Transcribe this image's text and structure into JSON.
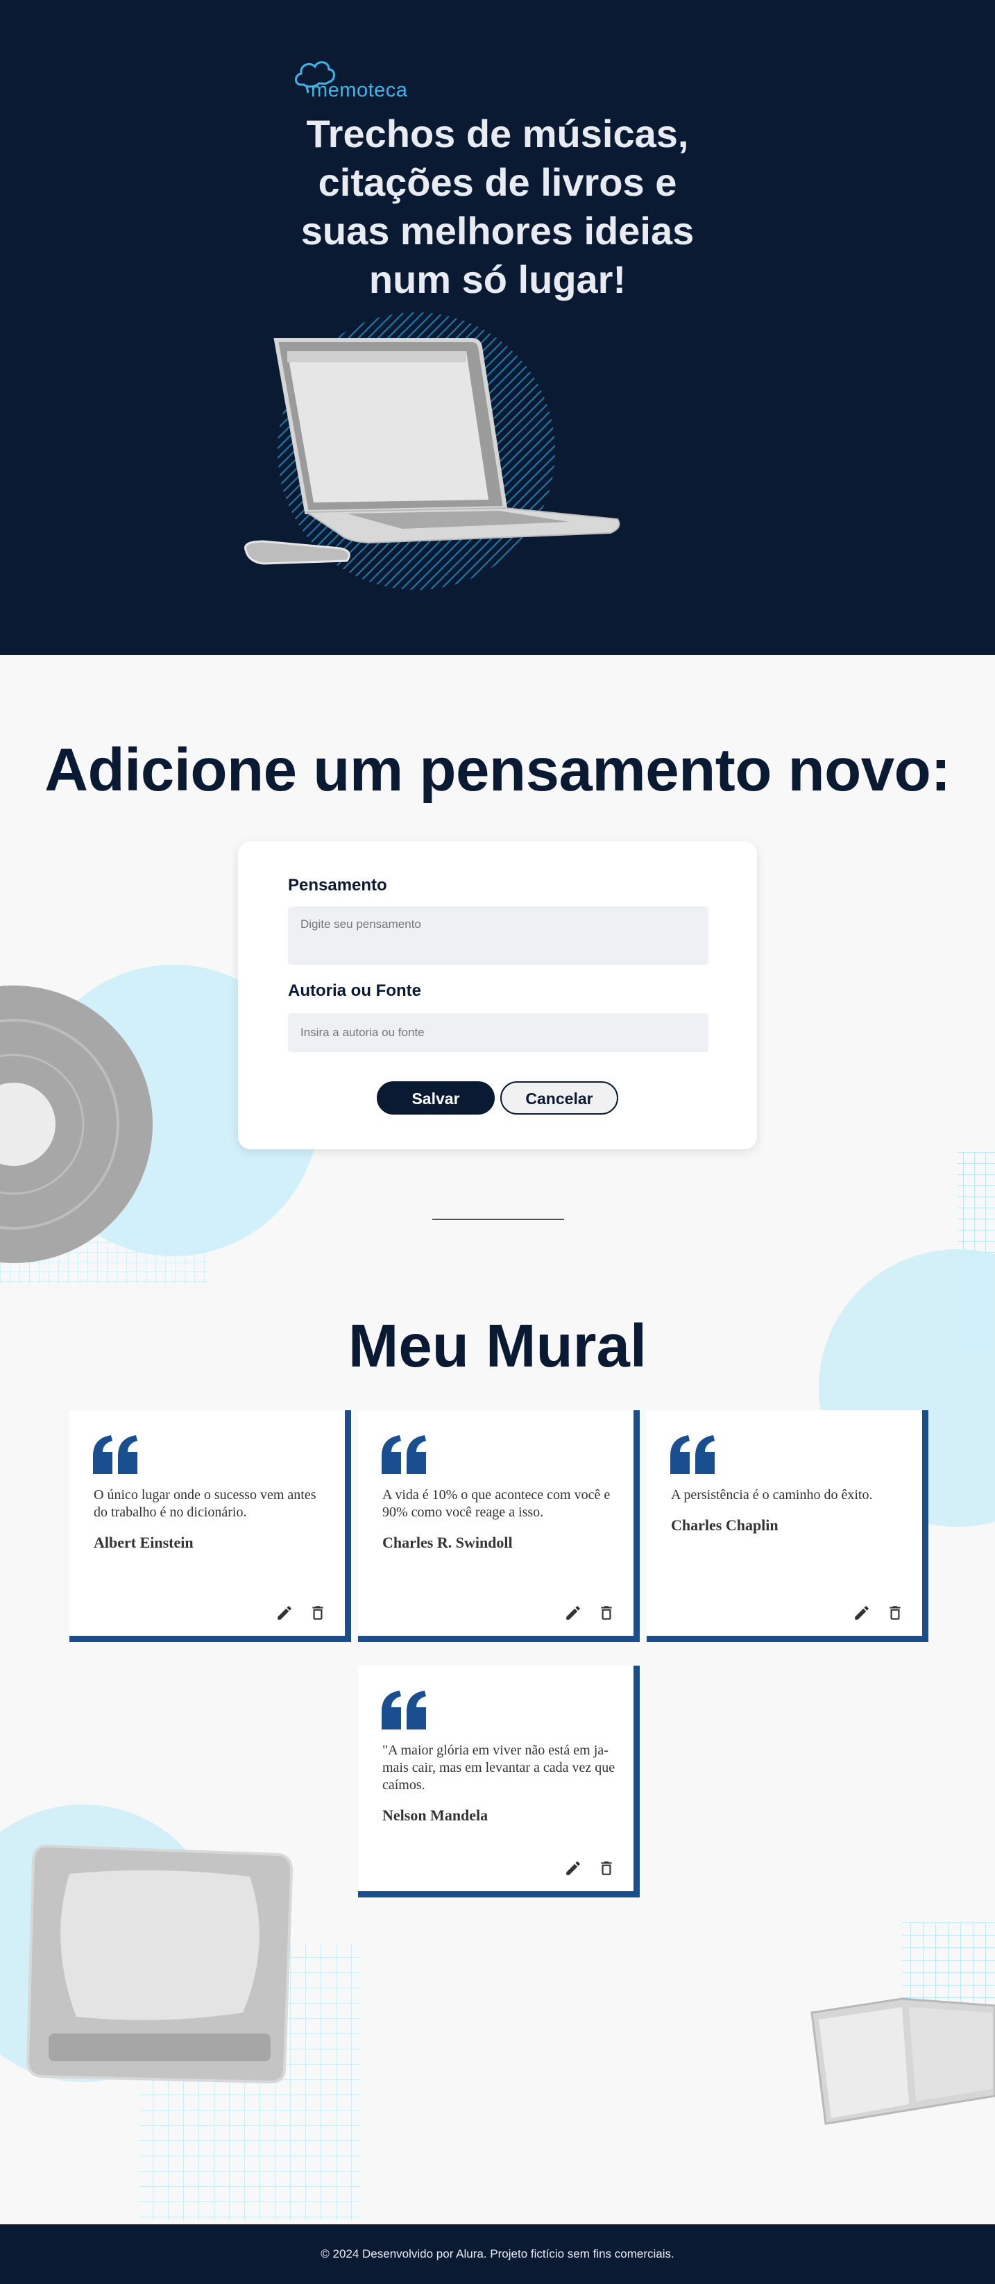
{
  "brand": {
    "logo_text": "memoteca"
  },
  "hero": {
    "line1": "Trechos de músicas,",
    "line2": "citações de livros e",
    "line3": "suas melhores ideias",
    "line4": "num só lugar!"
  },
  "form": {
    "heading": "Adicione um pensamento novo:",
    "thought_label": "Pensamento",
    "thought_placeholder": "Digite seu pensamento",
    "author_label": "Autoria ou Fonte",
    "author_placeholder": "Insira a autoria ou fonte",
    "save_label": "Salvar",
    "cancel_label": "Cancelar"
  },
  "mural": {
    "title": "Meu Mural",
    "cards": [
      {
        "text": "O único lugar onde o sucesso vem antes do trabalho é no dicionário.",
        "author": "Albert Einstein"
      },
      {
        "text": "A vida é 10% o que acontece com você e 90% como você reage a isso.",
        "author": "Charles R. Swindoll"
      },
      {
        "text": "A persistência é o caminho do êxito.",
        "author": "Charles Chaplin"
      },
      {
        "text": "\"A maior glória em viver não está em ja-mais cair, mas em levantar a cada vez que caímos.",
        "author": "Nelson Mandela"
      }
    ]
  },
  "footer": {
    "text": "© 2024 Desenvolvido por Alura. Projeto fictício sem fins comerciais."
  },
  "colors": {
    "navy": "#0b1a33",
    "accent_blue": "#1a4f8f",
    "logo_cyan": "#3fb5e6",
    "light_cyan": "#bfe8f5"
  },
  "icons": {
    "edit": "pencil-icon",
    "delete": "trash-icon",
    "quote": "quote-icon",
    "logo": "cloud-icon"
  }
}
